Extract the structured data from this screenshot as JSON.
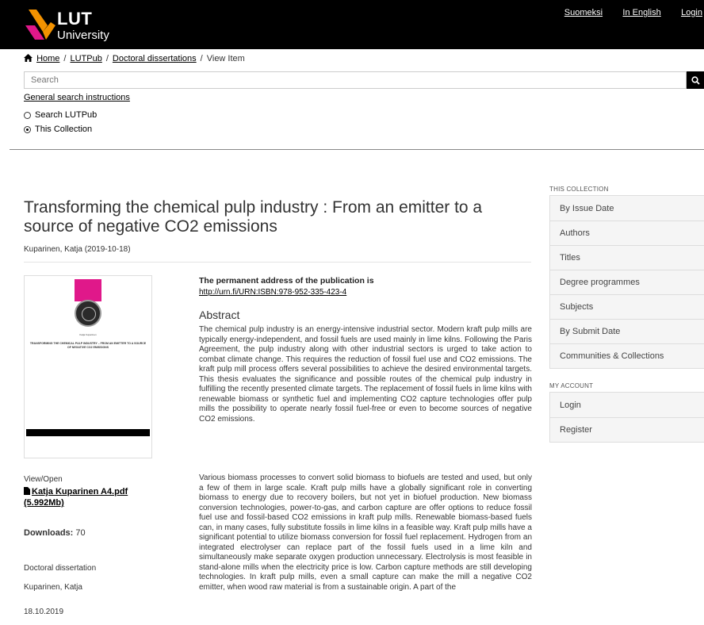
{
  "header": {
    "logo_primary": "LUT",
    "logo_secondary": "University",
    "links": [
      "Suomeksi",
      "In English",
      "Login"
    ]
  },
  "breadcrumb": {
    "items": [
      "Home",
      "LUTPub",
      "Doctoral dissertations"
    ],
    "current": "View Item",
    "separator": "/"
  },
  "search": {
    "placeholder": "Search",
    "help_link": "General search instructions",
    "scope_options": [
      "Search LUTPub",
      "This Collection"
    ],
    "selected_scope": "This Collection"
  },
  "item": {
    "title": "Transforming the chemical pulp industry : From an emitter to a source of negative CO2 emissions",
    "author_date": "Kuparinen, Katja (2019-10-18)",
    "thumbnail": {
      "author": "Katja Kuparinen",
      "title": "TRANSFORMING THE CHEMICAL PULP INDUSTRY – FROM AN EMITTER TO A SOURCE OF NEGATIVE CO2 EMISSIONS"
    },
    "view_open_label": "View/Open",
    "file_link": "Katja Kuparinen A4.pdf (5.992Mb)",
    "downloads_label": "Downloads:",
    "downloads_value": "70",
    "type": "Doctoral dissertation",
    "author": "Kuparinen, Katja",
    "date": "18.10.2019",
    "permanent_address_label": "The permanent address of the publication is",
    "permanent_address_url": "http://urn.fi/URN:ISBN:978-952-335-423-4",
    "abstract_heading": "Abstract",
    "abstract_paragraphs": [
      "The chemical pulp industry is an energy-intensive industrial sector. Modern kraft pulp mills are typically energy-independent, and fossil fuels are used mainly in lime kilns. Following the Paris Agreement, the pulp industry along with other industrial sectors is urged to take action to combat climate change. This requires the reduction of fossil fuel use and CO2 emissions. The kraft pulp mill process offers several possibilities to achieve the desired environmental targets. This thesis evaluates the significance and possible routes of the chemical pulp industry in fulfilling the recently presented climate targets. The replacement of fossil fuels in lime kilns with renewable biomass or synthetic fuel and implementing CO2 capture technologies offer pulp mills the possibility to operate nearly fossil fuel-free or even to become sources of negative CO2 emissions.",
      "Various biomass processes to convert solid biomass to biofuels are tested and used, but only a few of them in large scale. Kraft pulp mills have a globally significant role in converting biomass to energy due to recovery boilers, but not yet in biofuel production. New biomass conversion technologies, power-to-gas, and carbon capture are offer options to reduce fossil fuel use and fossil-based CO2 emissions in kraft pulp mills. Renewable biomass-based fuels can, in many cases, fully substitute fossils in lime kilns in a feasible way. Kraft pulp mills have a significant potential to utilize biomass conversion for fossil fuel replacement. Hydrogen from an integrated electrolyser can replace part of the fossil fuels used in a lime kiln and simultaneously make separate oxygen production unnecessary. Electrolysis is most feasible in stand-alone mills when the electricity price is low. Carbon capture methods are still developing technologies. In kraft pulp mills, even a small capture can make the mill a negative CO2 emitter, when wood raw material is from a sustainable origin. A part of the"
    ]
  },
  "sidebar": {
    "collection_heading": "THIS COLLECTION",
    "collection_items": [
      "By Issue Date",
      "Authors",
      "Titles",
      "Degree programmes",
      "Subjects",
      "By Submit Date",
      "Communities & Collections"
    ],
    "account_heading": "MY ACCOUNT",
    "account_items": [
      "Login",
      "Register"
    ]
  },
  "colors": {
    "header_bg": "#000000",
    "logo_orange": "#f39200",
    "logo_pink": "#e0188a",
    "sidebar_bg": "#f5f5f5"
  }
}
